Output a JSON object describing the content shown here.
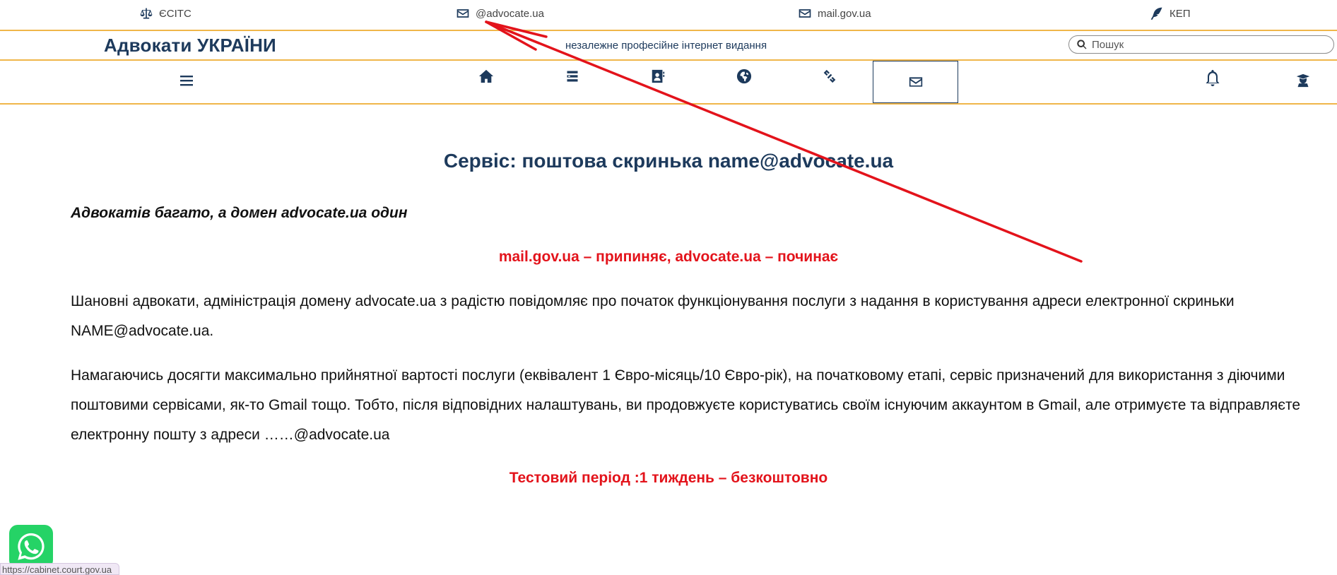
{
  "toplinks": [
    {
      "label": "ЄСІТС",
      "icon": "scales-icon"
    },
    {
      "label": "@advocate.ua",
      "icon": "envelope-icon"
    },
    {
      "label": "mail.gov.ua",
      "icon": "envelope-icon"
    },
    {
      "label": "КЕП",
      "icon": "feather-icon"
    }
  ],
  "header": {
    "brand": "Адвокати УКРАЇНИ",
    "tagline": "незалежне професійне інтернет видання",
    "search_placeholder": "Пошук"
  },
  "nav": {
    "icons": [
      "menu-icon",
      "home-icon",
      "list-icon",
      "contacts-icon",
      "globe-icon",
      "link-icon",
      "mail-icon",
      "bell-icon",
      "graduate-icon"
    ],
    "active": "mail-icon"
  },
  "content": {
    "title": "Сервіс: поштова скринька name@advocate.ua",
    "lead": "Адвокатів багато, а домен advocate.ua один",
    "red1": "mail.gov.ua – припиняє, advocate.ua – починає",
    "para1": "Шановні адвокати, адміністрація домену advocate.ua з радістю повідомляє про початок функціонування  послуги  з надання в користування адреси електронної скриньки NAME@advocate.ua.",
    "para2": "Намагаючись досягти максимально прийнятної вартості послуги (еквівалент 1 Євро-місяць/10 Євро-рік), на початковому етапі, сервіс призначений для використання з діючими поштовими сервісами, як-то  Gmail  тощо. Тобто, після відповідних налаштувань, ви продовжуєте користуватись своїм існуючим аккаунтом в Gmail, але отримуєте та відправляєте  електронну пошту з адреси ……@advocate.ua",
    "red2": "Тестовий період :1 тиждень – безкоштовно"
  },
  "status_url": "https://cabinet.court.gov.ua",
  "colors": {
    "accent": "#f0b64a",
    "brand": "#1d3a5c",
    "highlight": "#e3131b",
    "whatsapp": "#25d366"
  }
}
